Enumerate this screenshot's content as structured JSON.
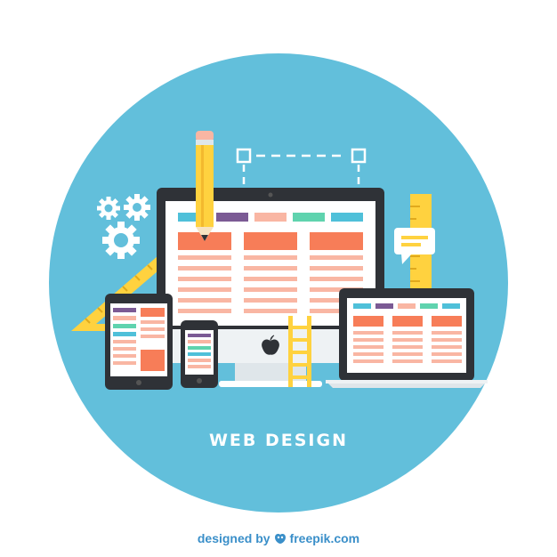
{
  "caption": "WEB DESIGN",
  "credit": {
    "prefix": "designed by",
    "brand": "freepik.com"
  },
  "icons": [
    "gear-icon",
    "pencil-icon",
    "ruler-icon",
    "set-square-icon",
    "ladder-icon",
    "chat-bubble-icon",
    "apple-logo-icon",
    "freepik-logo-icon"
  ],
  "colors": {
    "circle": "#62bfdb",
    "device_dark": "#2f3237",
    "accent_orange": "#f77d58",
    "pink_rows": "#f9b6a3",
    "purple": "#7b5a94",
    "green": "#5fd3ae",
    "blue": "#4fc0d9",
    "yellow": "#ffd23f",
    "credit_blue": "#3a8fc9"
  }
}
